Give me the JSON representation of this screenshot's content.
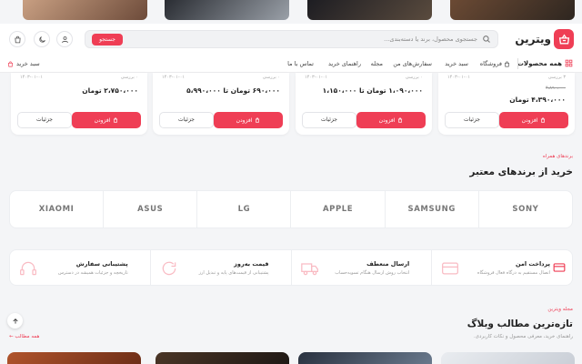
{
  "header": {
    "logo_text": "ویترین",
    "search_placeholder": "جستجوی محصول، برند یا دسته‌بندی...",
    "search_button": "جستجو"
  },
  "nav": {
    "all_products": "همه محصولات",
    "items": [
      "فروشگاه",
      "سبد خرید",
      "سفارش‌های من",
      "مجله",
      "راهنمای خرید",
      "تماس با ما"
    ],
    "cart": "سبد خرید"
  },
  "products": [
    {
      "meta_right": "۳ بررسی",
      "meta_left": "۱۴۰۳-۰۱-۰۱",
      "old_price": "۴،۸۹۰،۰۰۰",
      "price": "۴،۳۹۰،۰۰۰ تومان",
      "add_label": "افزودن",
      "details_label": "جزئیات"
    },
    {
      "meta_right": "۰ بررسی",
      "meta_left": "۱۴۰۳-۰۱-۰۱",
      "price": "۱،۰۹۰،۰۰۰ تومان تا ۱،۱۵۰،۰۰۰",
      "add_label": "افزودن",
      "details_label": "جزئیات"
    },
    {
      "meta_right": "۰ بررسی",
      "meta_left": "۱۴۰۳-۰۱-۰۱",
      "price": "۶۹۰،۰۰۰ تومان تا ۵،۹۹۰،۰۰۰",
      "add_label": "افزودن",
      "details_label": "جزئیات"
    },
    {
      "meta_right": "۰ بررسی",
      "meta_left": "۱۴۰۳-۰۱-۰۱",
      "price": "۲،۷۵۰،۰۰۰ تومان",
      "add_label": "افزودن",
      "details_label": "جزئیات"
    }
  ],
  "brands_section": {
    "kicker": "برندهای همراه",
    "title": "خرید از برندهای معتبر",
    "brands": [
      "SONY",
      "SAMSUNG",
      "APPLE",
      "LG",
      "ASUS",
      "XIAOMI"
    ]
  },
  "features": [
    {
      "title": "پرداخت امن",
      "desc": "اتصال مستقیم به درگاه فعال فروشگاه"
    },
    {
      "title": "ارسال منعطف",
      "desc": "انتخاب روش ارسال هنگام تسویه‌حساب"
    },
    {
      "title": "قیمت به‌روز",
      "desc": "پشتیبانی از قیمت‌های پایه و تبدیل ارز"
    },
    {
      "title": "پشتیبانی سفارش",
      "desc": "تاریخچه و جزئیات همیشه در دسترس"
    }
  ],
  "blog_section": {
    "kicker": "مجله ویترین",
    "title": "تازه‌ترین مطالب وبلاگ",
    "subtitle": "راهنمای خرید، معرفی محصول و نکات کاربردی.",
    "all_link": "همه مطالب"
  },
  "colors": {
    "accent": "#ef3e55",
    "page_bg": "#f4f5f7"
  }
}
